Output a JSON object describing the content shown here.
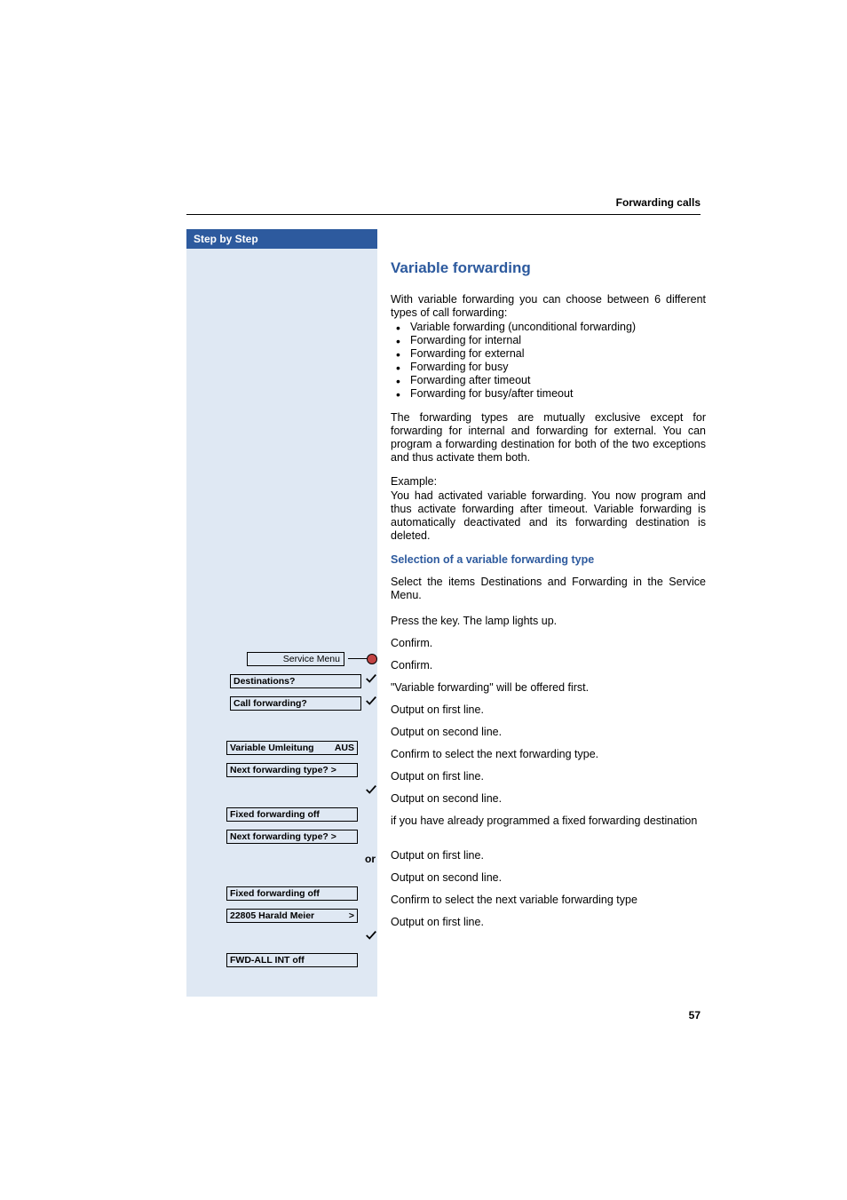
{
  "header": {
    "section": "Forwarding calls"
  },
  "sidebar": {
    "title": "Step by Step",
    "rows": [
      {
        "type": "menu-key",
        "label": "Service Menu"
      },
      {
        "type": "menu-check",
        "label": "Destinations?",
        "bold": true
      },
      {
        "type": "menu-check",
        "label": "Call forwarding?",
        "bold": true
      },
      {
        "type": "blank"
      },
      {
        "type": "menu-plain",
        "left": "Variable Umleitung",
        "right": "AUS",
        "bold": true
      },
      {
        "type": "menu-plain",
        "left": "Next forwarding type?  >",
        "bold": true
      },
      {
        "type": "check-only"
      },
      {
        "type": "menu-plain",
        "left": "Fixed forwarding  off",
        "bold": true
      },
      {
        "type": "menu-plain",
        "left": "Next forwarding type?  >",
        "bold": true
      },
      {
        "type": "or"
      },
      {
        "type": "blank-short"
      },
      {
        "type": "menu-plain",
        "left": "Fixed forwarding  off",
        "bold": true
      },
      {
        "type": "menu-plain",
        "left": "22805 Harald Meier",
        "right": ">",
        "bold": true
      },
      {
        "type": "check-only"
      },
      {
        "type": "menu-plain",
        "left": "FWD-ALL INT off",
        "bold": true
      }
    ],
    "or_label": "or"
  },
  "main": {
    "title": "Variable forwarding",
    "intro": "With variable forwarding you can choose between 6 different types of call forwarding:",
    "bullets": [
      "Variable forwarding (unconditional forwarding)",
      "Forwarding for internal",
      "Forwarding for external",
      "Forwarding for busy",
      "Forwarding after timeout",
      "Forwarding for busy/after timeout"
    ],
    "para2": "The forwarding types are mutually exclusive except for forwarding for internal and forwarding for external. You can program a forwarding destination for both of the two exceptions and thus activate them both.",
    "example_label": "Example:",
    "example_text": "You had activated variable forwarding. You now program and thus activate forwarding after timeout. Variable forwarding is automatically deactivated and its forwarding destination is deleted.",
    "subheading": "Selection of a variable forwarding type",
    "para3": "Select the items Destinations and Forwarding in the Service Menu.",
    "steps": [
      "Press the key. The lamp lights up.",
      "Confirm.",
      "Confirm.",
      "\"Variable forwarding\" will be offered first.",
      "Output on first line.",
      "Output on second line.",
      "Confirm to select the next forwarding type.",
      "Output on first line.",
      "Output on second line.",
      "if you have already programmed a fixed forwarding destination",
      "Output on first line.",
      "Output on second line.",
      "Confirm to select the next variable forwarding type",
      "Output on first line."
    ]
  },
  "page_number": "57"
}
